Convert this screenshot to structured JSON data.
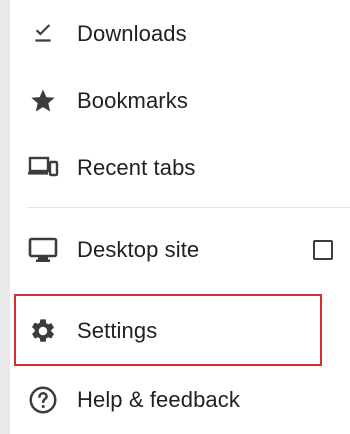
{
  "menu": {
    "items": [
      {
        "label": "Downloads",
        "icon": "download-done-icon"
      },
      {
        "label": "Bookmarks",
        "icon": "star-icon"
      },
      {
        "label": "Recent tabs",
        "icon": "devices-icon"
      },
      {
        "label": "Desktop site",
        "icon": "monitor-icon",
        "checkbox": {
          "checked": false
        }
      },
      {
        "label": "Settings",
        "icon": "gear-icon"
      },
      {
        "label": "Help & feedback",
        "icon": "help-circle-icon"
      }
    ]
  },
  "colors": {
    "text": "#202124",
    "icon": "#3c3c3c",
    "divider": "#e2e2e2",
    "highlight_border": "#d32f2f",
    "menu_background": "#ffffff"
  }
}
